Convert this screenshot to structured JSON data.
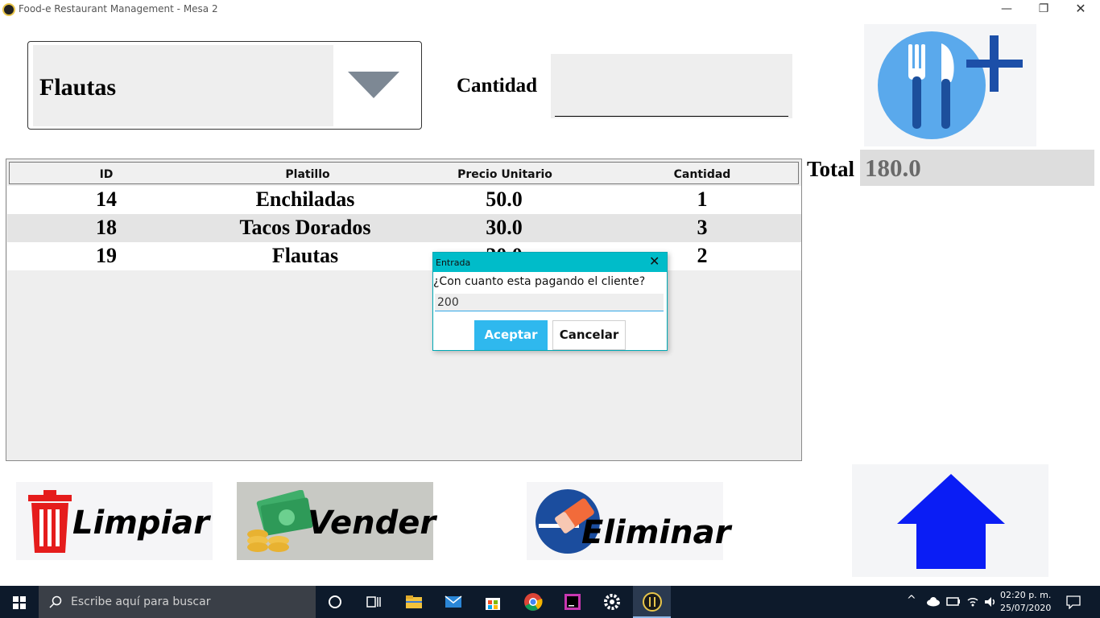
{
  "window": {
    "title": "Food-e Restaurant Management - Mesa 2",
    "minimize": "—",
    "maximize": "❐",
    "close": "✕"
  },
  "combo": {
    "selected": "Flautas"
  },
  "quantity": {
    "label": "Cantidad",
    "value": ""
  },
  "total": {
    "label": "Total",
    "value": "180.0"
  },
  "table": {
    "headers": [
      "ID",
      "Platillo",
      "Precio Unitario",
      "Cantidad"
    ],
    "rows": [
      {
        "id": "14",
        "platillo": "Enchiladas",
        "precio": "50.0",
        "cantidad": "1"
      },
      {
        "id": "18",
        "platillo": "Tacos Dorados",
        "precio": "30.0",
        "cantidad": "3"
      },
      {
        "id": "19",
        "platillo": "Flautas",
        "precio": "20.0",
        "cantidad": "2"
      }
    ]
  },
  "dialog": {
    "title": "Entrada",
    "close": "✕",
    "message": "¿Con cuanto esta pagando el cliente?",
    "input_value": "200",
    "ok_label": "Aceptar",
    "cancel_label": "Cancelar"
  },
  "buttons": {
    "clear": "Limpiar",
    "sell": "Vender",
    "delete": "Eliminar"
  },
  "taskbar": {
    "search_placeholder": "Escribe aquí para buscar",
    "time": "02:20 p. m.",
    "date": "25/07/2020"
  },
  "colors": {
    "dialog_title": "#00bcc9",
    "ok_button": "#2fb8ee",
    "home_icon": "#0a1df5",
    "trash_icon": "#e51c1c",
    "taskbar": "#0d1a2b"
  },
  "icons": {
    "add": "cutlery-plus-icon",
    "clear": "trash-icon",
    "sell": "money-icon",
    "delete": "eraser-icon",
    "home": "home-icon"
  }
}
